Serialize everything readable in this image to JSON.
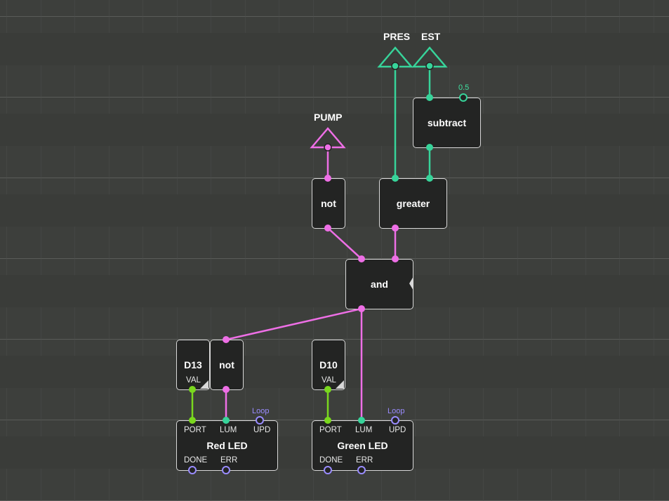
{
  "colors": {
    "background": "#3d3f3c",
    "node_fill": "#232423",
    "node_border": "#d8d8d8",
    "boolean_wire": "#ee6fe6",
    "number_wire": "#37d49a",
    "port_wire": "#7ad81e",
    "pulse_pin": "#9a8cff"
  },
  "inputs": {
    "pres": "PRES",
    "est": "EST"
  },
  "outputs": {
    "pump": "PUMP"
  },
  "nodes": {
    "subtract": {
      "label": "subtract",
      "const_value": "0.5"
    },
    "greater": {
      "label": "greater"
    },
    "not_top": {
      "label": "not"
    },
    "and": {
      "label": "and"
    },
    "d13": {
      "label": "D13",
      "pin": "VAL"
    },
    "not_bottom": {
      "label": "not"
    },
    "d10": {
      "label": "D10",
      "pin": "VAL"
    },
    "red_led": {
      "label": "Red LED",
      "pins_top": [
        "PORT",
        "LUM",
        "UPD"
      ],
      "pins_bottom": [
        "DONE",
        "ERR"
      ],
      "loop": "Loop"
    },
    "green_led": {
      "label": "Green LED",
      "pins_top": [
        "PORT",
        "LUM",
        "UPD"
      ],
      "pins_bottom": [
        "DONE",
        "ERR"
      ],
      "loop": "Loop"
    }
  }
}
